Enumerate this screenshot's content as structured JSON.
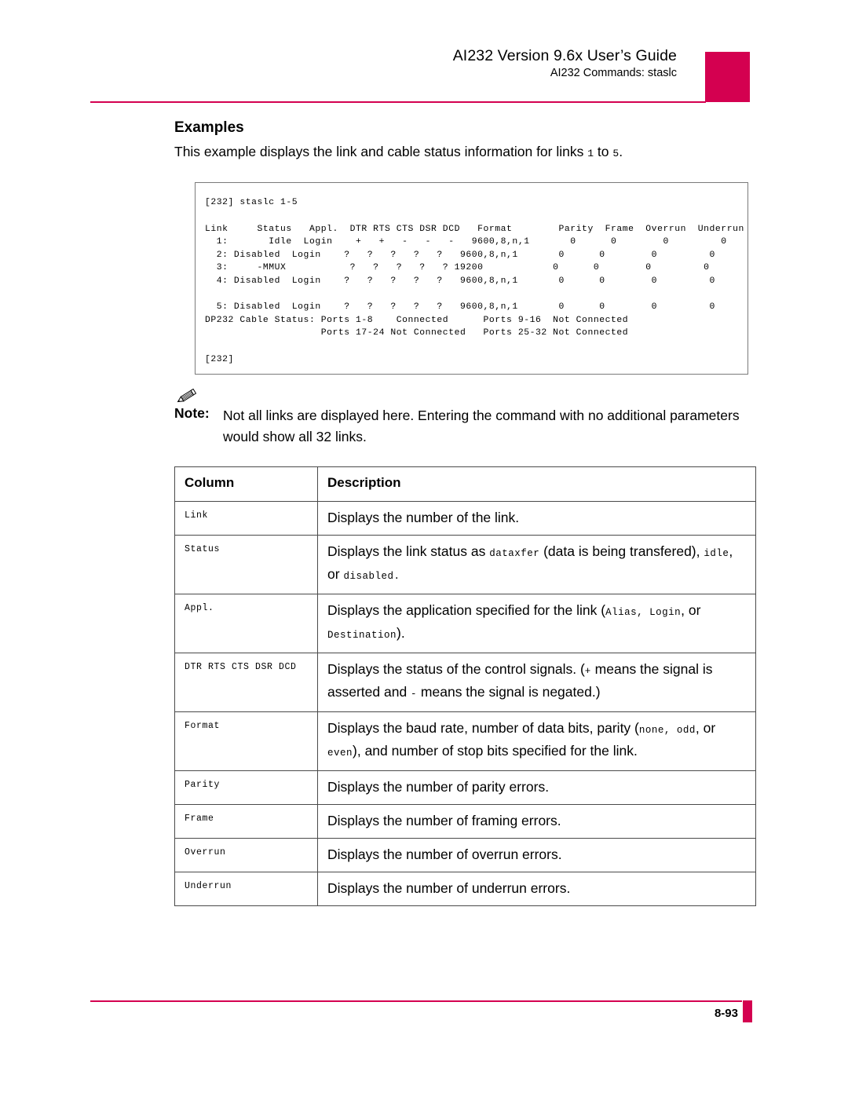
{
  "header": {
    "title": "AI232 Version 9.6x User’s Guide",
    "subtitle": "AI232 Commands: staslc",
    "accent_color": "#D40050"
  },
  "section": {
    "heading": "Examples",
    "intro_before": "This example displays the link and cable status information for links ",
    "intro_link_start": "1",
    "intro_mid": " to ",
    "intro_link_end": "5",
    "intro_after": "."
  },
  "terminal": {
    "content": "[232] staslc 1-5\n\nLink     Status   Appl.  DTR RTS CTS DSR DCD   Format        Parity  Frame  Overrun  Underrun\n  1:       Idle  Login    +   +   -   -   -   9600,8,n,1       0      0        0         0\n  2: Disabled  Login    ?   ?   ?   ?   ?   9600,8,n,1       0      0        0         0\n  3:     -MMUX           ?   ?   ?   ?   ? 19200            0      0        0         0\n  4: Disabled  Login    ?   ?   ?   ?   ?   9600,8,n,1       0      0        0         0\n\n  5: Disabled  Login    ?   ?   ?   ?   ?   9600,8,n,1       0      0        0         0\nDP232 Cable Status: Ports 1-8    Connected      Ports 9-16  Not Connected\n                    Ports 17-24 Not Connected   Ports 25-32 Not Connected\n\n[232]"
  },
  "note": {
    "icon": "pencil-icon",
    "label": "Note:",
    "body": "Not all links are displayed here. Entering the command with no additional parameters would show all 32 links."
  },
  "table": {
    "headers": {
      "column": "Column",
      "description": "Description"
    },
    "rows": [
      {
        "name": "Link",
        "desc_parts": [
          {
            "text": "Displays the number of the link.",
            "mono": false
          }
        ]
      },
      {
        "name": "Status",
        "desc_parts": [
          {
            "text": "Displays the link status as ",
            "mono": false
          },
          {
            "text": "dataxfer",
            "mono": true
          },
          {
            "text": " (data is being transfered), ",
            "mono": false
          },
          {
            "text": "idle",
            "mono": true
          },
          {
            "text": ", or ",
            "mono": false
          },
          {
            "text": "disabled",
            "mono": true
          },
          {
            "text": ".",
            "mono": true
          }
        ]
      },
      {
        "name": "Appl.",
        "desc_parts": [
          {
            "text": "Displays the application specified for the link (",
            "mono": false
          },
          {
            "text": "Alias",
            "mono": true
          },
          {
            "text": ", ",
            "mono": true
          },
          {
            "text": "Login",
            "mono": true
          },
          {
            "text": ", or ",
            "mono": false
          },
          {
            "text": "Destination",
            "mono": true
          },
          {
            "text": ").",
            "mono": false
          }
        ]
      },
      {
        "name": "DTR RTS CTS DSR DCD",
        "desc_parts": [
          {
            "text": "Displays the status of the control signals. (",
            "mono": false
          },
          {
            "text": "+",
            "mono": true
          },
          {
            "text": " means the signal is asserted and ",
            "mono": false
          },
          {
            "text": "-",
            "mono": true
          },
          {
            "text": " means the signal is negated.)",
            "mono": false
          }
        ]
      },
      {
        "name": "Format",
        "desc_parts": [
          {
            "text": "Displays the baud rate, number of data bits, parity (",
            "mono": false
          },
          {
            "text": "none",
            "mono": true
          },
          {
            "text": ", ",
            "mono": true
          },
          {
            "text": "odd",
            "mono": true
          },
          {
            "text": ", or ",
            "mono": false
          },
          {
            "text": "even",
            "mono": true
          },
          {
            "text": "), and number of stop bits specified for the link.",
            "mono": false
          }
        ]
      },
      {
        "name": "Parity",
        "desc_parts": [
          {
            "text": "Displays the number of parity errors.",
            "mono": false
          }
        ]
      },
      {
        "name": "Frame",
        "desc_parts": [
          {
            "text": "Displays the number of framing errors.",
            "mono": false
          }
        ]
      },
      {
        "name": "Overrun",
        "desc_parts": [
          {
            "text": "Displays the number of overrun errors.",
            "mono": false
          }
        ]
      },
      {
        "name": "Underrun",
        "desc_parts": [
          {
            "text": "Displays the number of underrun errors.",
            "mono": false
          }
        ]
      }
    ]
  },
  "footer": {
    "page_number": "8-93"
  }
}
